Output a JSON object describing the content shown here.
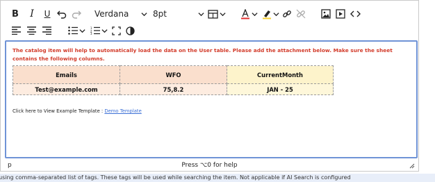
{
  "toolbar": {
    "font_family": "Verdana",
    "font_size": "8pt"
  },
  "content": {
    "intro_text": "The catalog item will help to automatically load the data on the User table. Please add the attachment below. Make sure the sheet contains the following columns.",
    "table": {
      "headers": [
        "Emails",
        "WFO",
        "CurrentMonth"
      ],
      "rows": [
        [
          "Test@example.com",
          "75,8.2",
          "JAN - 25"
        ]
      ]
    },
    "template_prefix": "Click here to View Example Template : ",
    "template_link": "Demo Template"
  },
  "status_bar": {
    "element_path": "p",
    "help_text": "Press ⌥0 for help"
  },
  "hint_text": "using comma-separated list of tags. These tags will be used while searching the item. Not applicable if AI Search is configured"
}
